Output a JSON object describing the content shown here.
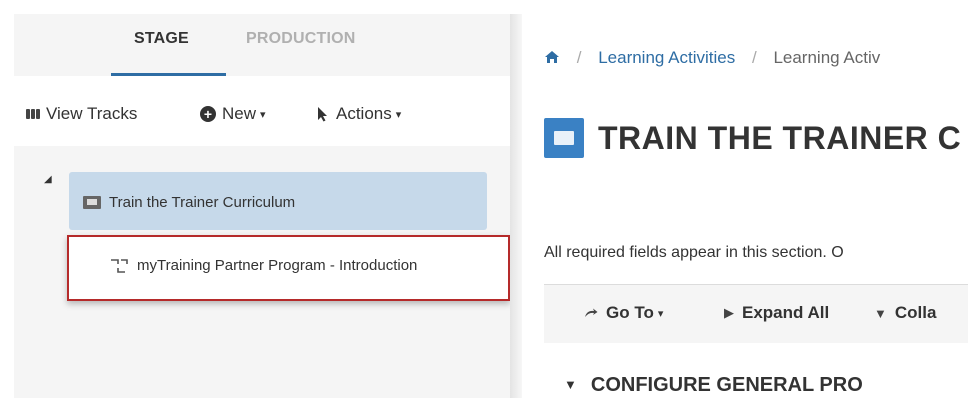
{
  "left": {
    "tabs": [
      {
        "label": "STAGE",
        "active": true
      },
      {
        "label": "PRODUCTION",
        "active": false
      }
    ],
    "toolbar": {
      "view_tracks": "View Tracks",
      "new": "New",
      "actions": "Actions",
      "caret": "▾"
    },
    "tree": {
      "toggle": "◢",
      "curriculum": {
        "label": "Train the Trainer Curriculum",
        "icon": "curriculum-icon"
      },
      "program": {
        "label": "myTraining Partner Program - Introduction",
        "icon": "program-icon"
      }
    }
  },
  "right": {
    "breadcrumb": {
      "separator": "/",
      "items": [
        "Learning Activities",
        "Learning Activ"
      ]
    },
    "title": "TRAIN THE TRAINER C",
    "required_note": "All required fields appear in this section. O",
    "actionbar": {
      "goto": "Go To",
      "expand_all": "Expand All",
      "collapse": "Colla",
      "caret": "▾"
    },
    "section_heading": "CONFIGURE GENERAL PRO"
  },
  "colors": {
    "accent": "#2e6da4",
    "selected_bg": "#c6d9ea",
    "highlight_border": "#b52a2a",
    "title_icon": "#3a81c4"
  }
}
